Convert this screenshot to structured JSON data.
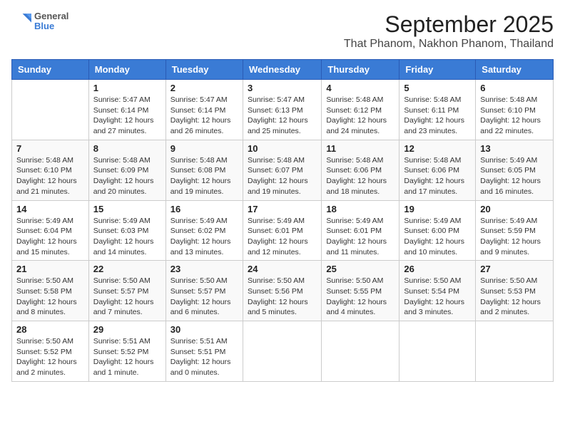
{
  "header": {
    "logo_general": "General",
    "logo_blue": "Blue",
    "title": "September 2025",
    "subtitle": "That Phanom, Nakhon Phanom, Thailand"
  },
  "columns": [
    "Sunday",
    "Monday",
    "Tuesday",
    "Wednesday",
    "Thursday",
    "Friday",
    "Saturday"
  ],
  "weeks": [
    [
      {
        "day": "",
        "sunrise": "",
        "sunset": "",
        "daylight": ""
      },
      {
        "day": "1",
        "sunrise": "Sunrise: 5:47 AM",
        "sunset": "Sunset: 6:14 PM",
        "daylight": "Daylight: 12 hours and 27 minutes."
      },
      {
        "day": "2",
        "sunrise": "Sunrise: 5:47 AM",
        "sunset": "Sunset: 6:14 PM",
        "daylight": "Daylight: 12 hours and 26 minutes."
      },
      {
        "day": "3",
        "sunrise": "Sunrise: 5:47 AM",
        "sunset": "Sunset: 6:13 PM",
        "daylight": "Daylight: 12 hours and 25 minutes."
      },
      {
        "day": "4",
        "sunrise": "Sunrise: 5:48 AM",
        "sunset": "Sunset: 6:12 PM",
        "daylight": "Daylight: 12 hours and 24 minutes."
      },
      {
        "day": "5",
        "sunrise": "Sunrise: 5:48 AM",
        "sunset": "Sunset: 6:11 PM",
        "daylight": "Daylight: 12 hours and 23 minutes."
      },
      {
        "day": "6",
        "sunrise": "Sunrise: 5:48 AM",
        "sunset": "Sunset: 6:10 PM",
        "daylight": "Daylight: 12 hours and 22 minutes."
      }
    ],
    [
      {
        "day": "7",
        "sunrise": "Sunrise: 5:48 AM",
        "sunset": "Sunset: 6:10 PM",
        "daylight": "Daylight: 12 hours and 21 minutes."
      },
      {
        "day": "8",
        "sunrise": "Sunrise: 5:48 AM",
        "sunset": "Sunset: 6:09 PM",
        "daylight": "Daylight: 12 hours and 20 minutes."
      },
      {
        "day": "9",
        "sunrise": "Sunrise: 5:48 AM",
        "sunset": "Sunset: 6:08 PM",
        "daylight": "Daylight: 12 hours and 19 minutes."
      },
      {
        "day": "10",
        "sunrise": "Sunrise: 5:48 AM",
        "sunset": "Sunset: 6:07 PM",
        "daylight": "Daylight: 12 hours and 19 minutes."
      },
      {
        "day": "11",
        "sunrise": "Sunrise: 5:48 AM",
        "sunset": "Sunset: 6:06 PM",
        "daylight": "Daylight: 12 hours and 18 minutes."
      },
      {
        "day": "12",
        "sunrise": "Sunrise: 5:48 AM",
        "sunset": "Sunset: 6:06 PM",
        "daylight": "Daylight: 12 hours and 17 minutes."
      },
      {
        "day": "13",
        "sunrise": "Sunrise: 5:49 AM",
        "sunset": "Sunset: 6:05 PM",
        "daylight": "Daylight: 12 hours and 16 minutes."
      }
    ],
    [
      {
        "day": "14",
        "sunrise": "Sunrise: 5:49 AM",
        "sunset": "Sunset: 6:04 PM",
        "daylight": "Daylight: 12 hours and 15 minutes."
      },
      {
        "day": "15",
        "sunrise": "Sunrise: 5:49 AM",
        "sunset": "Sunset: 6:03 PM",
        "daylight": "Daylight: 12 hours and 14 minutes."
      },
      {
        "day": "16",
        "sunrise": "Sunrise: 5:49 AM",
        "sunset": "Sunset: 6:02 PM",
        "daylight": "Daylight: 12 hours and 13 minutes."
      },
      {
        "day": "17",
        "sunrise": "Sunrise: 5:49 AM",
        "sunset": "Sunset: 6:01 PM",
        "daylight": "Daylight: 12 hours and 12 minutes."
      },
      {
        "day": "18",
        "sunrise": "Sunrise: 5:49 AM",
        "sunset": "Sunset: 6:01 PM",
        "daylight": "Daylight: 12 hours and 11 minutes."
      },
      {
        "day": "19",
        "sunrise": "Sunrise: 5:49 AM",
        "sunset": "Sunset: 6:00 PM",
        "daylight": "Daylight: 12 hours and 10 minutes."
      },
      {
        "day": "20",
        "sunrise": "Sunrise: 5:49 AM",
        "sunset": "Sunset: 5:59 PM",
        "daylight": "Daylight: 12 hours and 9 minutes."
      }
    ],
    [
      {
        "day": "21",
        "sunrise": "Sunrise: 5:50 AM",
        "sunset": "Sunset: 5:58 PM",
        "daylight": "Daylight: 12 hours and 8 minutes."
      },
      {
        "day": "22",
        "sunrise": "Sunrise: 5:50 AM",
        "sunset": "Sunset: 5:57 PM",
        "daylight": "Daylight: 12 hours and 7 minutes."
      },
      {
        "day": "23",
        "sunrise": "Sunrise: 5:50 AM",
        "sunset": "Sunset: 5:57 PM",
        "daylight": "Daylight: 12 hours and 6 minutes."
      },
      {
        "day": "24",
        "sunrise": "Sunrise: 5:50 AM",
        "sunset": "Sunset: 5:56 PM",
        "daylight": "Daylight: 12 hours and 5 minutes."
      },
      {
        "day": "25",
        "sunrise": "Sunrise: 5:50 AM",
        "sunset": "Sunset: 5:55 PM",
        "daylight": "Daylight: 12 hours and 4 minutes."
      },
      {
        "day": "26",
        "sunrise": "Sunrise: 5:50 AM",
        "sunset": "Sunset: 5:54 PM",
        "daylight": "Daylight: 12 hours and 3 minutes."
      },
      {
        "day": "27",
        "sunrise": "Sunrise: 5:50 AM",
        "sunset": "Sunset: 5:53 PM",
        "daylight": "Daylight: 12 hours and 2 minutes."
      }
    ],
    [
      {
        "day": "28",
        "sunrise": "Sunrise: 5:50 AM",
        "sunset": "Sunset: 5:52 PM",
        "daylight": "Daylight: 12 hours and 2 minutes."
      },
      {
        "day": "29",
        "sunrise": "Sunrise: 5:51 AM",
        "sunset": "Sunset: 5:52 PM",
        "daylight": "Daylight: 12 hours and 1 minute."
      },
      {
        "day": "30",
        "sunrise": "Sunrise: 5:51 AM",
        "sunset": "Sunset: 5:51 PM",
        "daylight": "Daylight: 12 hours and 0 minutes."
      },
      {
        "day": "",
        "sunrise": "",
        "sunset": "",
        "daylight": ""
      },
      {
        "day": "",
        "sunrise": "",
        "sunset": "",
        "daylight": ""
      },
      {
        "day": "",
        "sunrise": "",
        "sunset": "",
        "daylight": ""
      },
      {
        "day": "",
        "sunrise": "",
        "sunset": "",
        "daylight": ""
      }
    ]
  ]
}
